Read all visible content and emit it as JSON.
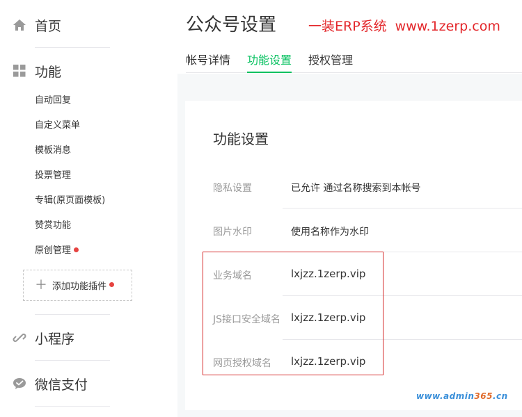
{
  "sidebar": {
    "home": {
      "label": "首页",
      "icon": "home-icon"
    },
    "features": {
      "label": "功能",
      "icon": "grid-icon"
    },
    "sub_items": [
      {
        "label": "自动回复"
      },
      {
        "label": "自定义菜单"
      },
      {
        "label": "模板消息"
      },
      {
        "label": "投票管理"
      },
      {
        "label": "专辑(原页面模板)"
      },
      {
        "label": "赞赏功能"
      },
      {
        "label": "原创管理",
        "dot": true
      }
    ],
    "add_plugin": {
      "label": "添加功能插件",
      "dot": true
    },
    "mini_program": {
      "label": "小程序",
      "icon": "link-icon"
    },
    "wechat_pay": {
      "label": "微信支付",
      "icon": "wechat-pay-icon"
    }
  },
  "header": {
    "title": "公众号设置",
    "watermark": "一装ERP系统",
    "watermark_url": "www.1zerp.com"
  },
  "tabs": [
    {
      "label": "帐号详情",
      "active": false
    },
    {
      "label": "功能设置",
      "active": true
    },
    {
      "label": "授权管理",
      "active": false
    }
  ],
  "settings": {
    "title": "功能设置",
    "rows": [
      {
        "label": "隐私设置",
        "value": "已允许 通过名称搜索到本帐号"
      },
      {
        "label": "图片水印",
        "value": "使用名称作为水印"
      },
      {
        "label": "业务域名",
        "value": "lxjzz.1zerp.vip"
      },
      {
        "label": "JS接口安全域名",
        "value": "lxjzz.1zerp.vip"
      },
      {
        "label": "网页授权域名",
        "value": "lxjzz.1zerp.vip"
      }
    ]
  },
  "footer_mark": {
    "part1": "www.admin",
    "part2": "365",
    "part3": ".cn"
  },
  "colors": {
    "accent": "#07c160",
    "red": "#e64340",
    "highlight": "#d62d2d",
    "watermark": "#e3262a"
  }
}
